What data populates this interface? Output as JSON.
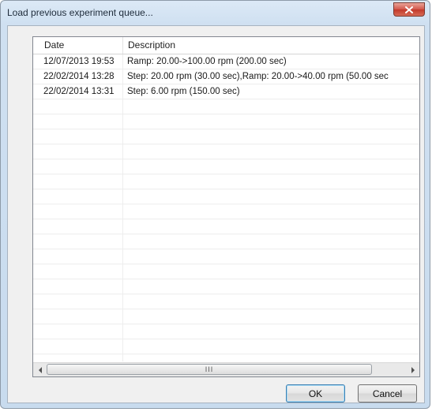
{
  "window": {
    "title": "Load previous experiment queue...",
    "close_icon": "close-icon"
  },
  "list": {
    "columns": [
      "Date",
      "Description"
    ],
    "rows": [
      {
        "date": "12/07/2013 19:53",
        "description": "Ramp: 20.00->100.00 rpm (200.00 sec)"
      },
      {
        "date": "22/02/2014 13:28",
        "description": "Step: 20.00 rpm (30.00 sec),Ramp: 20.00->40.00 rpm (50.00 sec"
      },
      {
        "date": "22/02/2014 13:31",
        "description": "Step: 6.00 rpm (150.00 sec)"
      }
    ],
    "scrollbar": {
      "left_icon": "arrow-left-icon",
      "right_icon": "arrow-right-icon",
      "grip": "III"
    }
  },
  "buttons": {
    "ok": "OK",
    "cancel": "Cancel"
  }
}
